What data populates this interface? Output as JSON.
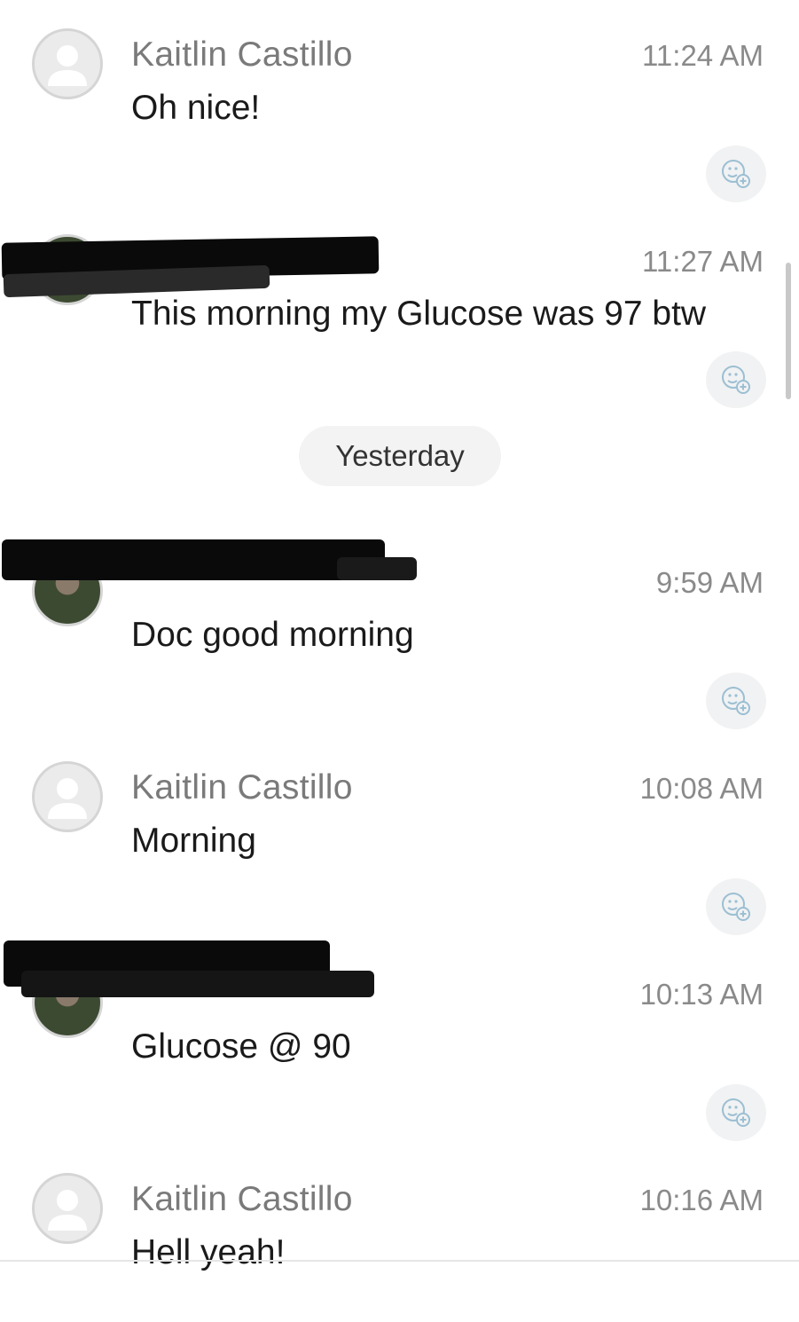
{
  "date_separator": "Yesterday",
  "messages": [
    {
      "sender": "Kaitlin Castillo",
      "time": "11:24 AM",
      "text": "Oh nice!",
      "avatar": "default-avatar-icon"
    },
    {
      "sender": "",
      "time": "11:27 AM",
      "text": "This morning my Glucose was 97 btw",
      "avatar": "photo"
    },
    {
      "sender": "",
      "time": "9:59 AM",
      "text": "Doc good morning",
      "avatar": "photo"
    },
    {
      "sender": "Kaitlin Castillo",
      "time": "10:08 AM",
      "text": "Morning",
      "avatar": "default-avatar-icon"
    },
    {
      "sender": "",
      "time": "10:13 AM",
      "text": "Glucose @ 90",
      "avatar": "photo"
    },
    {
      "sender": "Kaitlin Castillo",
      "time": "10:16 AM",
      "text": "Hell yeah!",
      "avatar": "default-avatar-icon"
    }
  ],
  "icons": {
    "reaction": "add-reaction-icon",
    "avatar": "default-avatar-icon"
  },
  "colors": {
    "time": "#8a8a8a",
    "sender": "#7a7a7a",
    "body": "#1a1a1a",
    "redaction": "#0a0a0a"
  }
}
